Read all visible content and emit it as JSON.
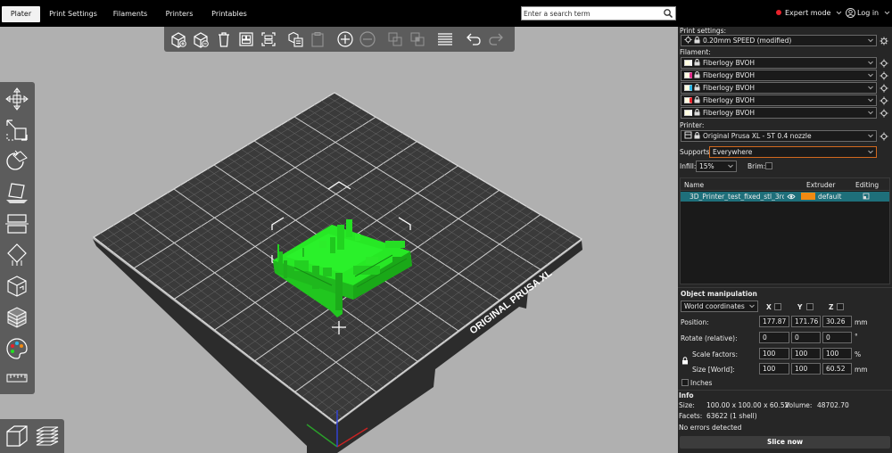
{
  "tabs": [
    {
      "label": "Plater",
      "active": true
    },
    {
      "label": "Print Settings",
      "active": false
    },
    {
      "label": "Filaments",
      "active": false
    },
    {
      "label": "Printers",
      "active": false
    },
    {
      "label": "Printables",
      "active": false
    }
  ],
  "search": {
    "placeholder": "Enter a search term"
  },
  "mode": {
    "label": "Expert mode",
    "indicator_color": "#e8222b"
  },
  "account": {
    "label": "Log in"
  },
  "bed": {
    "label": "ORIGINAL PRUSA XL"
  },
  "model": {
    "color": "#22e020"
  },
  "sidebar": {
    "print_settings_label": "Print settings:",
    "print_profile": "0.20mm SPEED (modified)",
    "filament_label": "Filament:",
    "filaments": [
      {
        "name": "Fiberlogy BVOH",
        "color": "#fffde0",
        "marker": "#f7f7f7"
      },
      {
        "name": "Fiberlogy BVOH",
        "color": "#fffde0",
        "marker": "#e0298a"
      },
      {
        "name": "Fiberlogy BVOH",
        "color": "#fffde0",
        "marker": "#2ab7e8"
      },
      {
        "name": "Fiberlogy BVOH",
        "color": "#fffde0",
        "marker": "#e8222b"
      },
      {
        "name": "Fiberlogy BVOH",
        "color": "#fffde0",
        "marker": "#f7f7f7"
      }
    ],
    "printer_label": "Printer:",
    "printer_profile": "Original Prusa XL - 5T 0.4 nozzle",
    "supports_label": "Supports:",
    "supports_value": "Everywhere",
    "infill_label": "Infill:",
    "infill_value": "15%",
    "brim_label": "Brim:",
    "objects_header": {
      "name": "Name",
      "extruder": "Extruder",
      "editing": "Editing"
    },
    "objects": [
      {
        "name": "3D_Printer_test_fixed_stl_3rd_ge",
        "extruder": "default",
        "extruder_color": "#f08a12"
      }
    ],
    "manipulation": {
      "title": "Object manipulation",
      "coords": "World coordinates",
      "axes": [
        "X",
        "Y",
        "Z"
      ],
      "position_label": "Position:",
      "position": [
        "177.87",
        "171.76",
        "30.26"
      ],
      "position_unit": "mm",
      "rotate_label": "Rotate (relative):",
      "rotate": [
        "0",
        "0",
        "0"
      ],
      "rotate_unit": "°",
      "scale_label": "Scale factors:",
      "scale": [
        "100",
        "100",
        "100"
      ],
      "scale_unit": "%",
      "size_label": "Size [World]:",
      "size": [
        "100",
        "100",
        "60.52"
      ],
      "size_unit": "mm",
      "inches_label": "Inches"
    },
    "info": {
      "title": "Info",
      "size_label": "Size:",
      "size_value": "100.00 x 100.00 x 60.52",
      "volume_label": "Volume:",
      "volume_value": "48702.70",
      "facets_label": "Facets:",
      "facets_value": "63622 (1 shell)",
      "errors": "No errors detected"
    },
    "slice_button": "Slice now"
  }
}
